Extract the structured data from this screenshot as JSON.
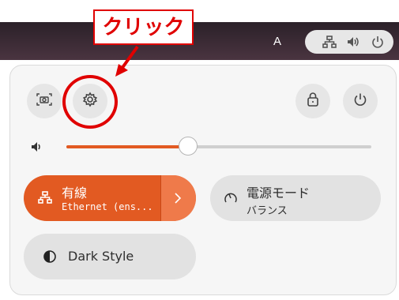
{
  "annotation": {
    "text": "クリック",
    "color": "#e00000"
  },
  "topbar": {
    "keyboard_indicator": "A"
  },
  "quick_settings": {
    "buttons": {
      "screenshot": "screenshot-icon",
      "settings": "gear-icon",
      "lock": "lock-icon",
      "power": "power-icon"
    },
    "volume": {
      "level": 0.4
    },
    "tiles": {
      "wired": {
        "title": "有線",
        "subtitle": "Ethernet (ens..."
      },
      "power_mode": {
        "title": "電源モード",
        "subtitle": "バランス"
      },
      "dark_style": {
        "title": "Dark Style"
      }
    },
    "accent": "#e25a22"
  }
}
